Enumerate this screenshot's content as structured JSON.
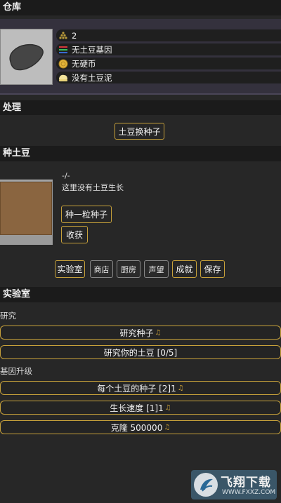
{
  "warehouse": {
    "title": "仓库",
    "items": [
      {
        "icon": "seed-pile-icon",
        "text": "2"
      },
      {
        "icon": "gene-icon",
        "text": "无土豆基因"
      },
      {
        "icon": "coin-icon",
        "text": "无硬币"
      },
      {
        "icon": "potato-mash-icon",
        "text": "没有土豆泥"
      }
    ]
  },
  "process": {
    "title": "处理",
    "exchange_button": "土豆换种子"
  },
  "plant": {
    "title": "种土豆",
    "status_code": "-/-",
    "status_text": "这里没有土豆生长",
    "plant_button": "种一粒种子",
    "harvest_button": "收获"
  },
  "nav": {
    "tabs": [
      "实验室",
      "商店",
      "厨房",
      "声望",
      "成就",
      "保存"
    ]
  },
  "lab": {
    "title": "实验室",
    "research_label": "研究",
    "research_seeds": "研究种子",
    "research_potato": "研究你的土豆 [0/5]",
    "gene_upgrade_label": "基因升级",
    "seeds_per_potato": "每个土豆的种子 [2]1",
    "growth_speed": "生长速度 [1]1",
    "clone": "克隆 500000"
  },
  "watermark": {
    "brand": "飞翔下载",
    "url": "WWW.FXXZ.COM"
  },
  "colors": {
    "accent_gold": "#c7a13a",
    "panel_purple": "#34313d",
    "soil": "#8a6540"
  }
}
